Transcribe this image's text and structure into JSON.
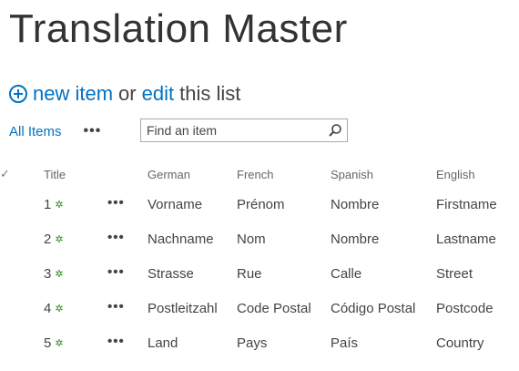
{
  "page": {
    "title": "Translation Master"
  },
  "command": {
    "new_item": "new item",
    "or": "or",
    "edit": "edit",
    "this_list": "this list"
  },
  "views": {
    "current": "All Items",
    "more": "•••"
  },
  "search": {
    "placeholder": "Find an item",
    "icon": "search-icon"
  },
  "table": {
    "columns": [
      "Title",
      "German",
      "French",
      "Spanish",
      "English"
    ],
    "checkmark": "✓",
    "new_marker": "✲",
    "row_menu": "•••",
    "rows": [
      {
        "title": "1",
        "german": "Vorname",
        "french": "Prénom",
        "spanish": "Nombre",
        "english": "Firstname"
      },
      {
        "title": "2",
        "german": "Nachname",
        "french": "Nom",
        "spanish": "Nombre",
        "english": "Lastname"
      },
      {
        "title": "3",
        "german": "Strasse",
        "french": "Rue",
        "spanish": "Calle",
        "english": "Street"
      },
      {
        "title": "4",
        "german": "Postleitzahl",
        "french": "Code Postal",
        "spanish": "Código Postal",
        "english": "Postcode"
      },
      {
        "title": "5",
        "german": "Land",
        "french": "Pays",
        "spanish": "País",
        "english": "Country"
      }
    ]
  },
  "colors": {
    "accent": "#0072c6",
    "new_marker": "#2e8b1e",
    "text": "#444444"
  }
}
